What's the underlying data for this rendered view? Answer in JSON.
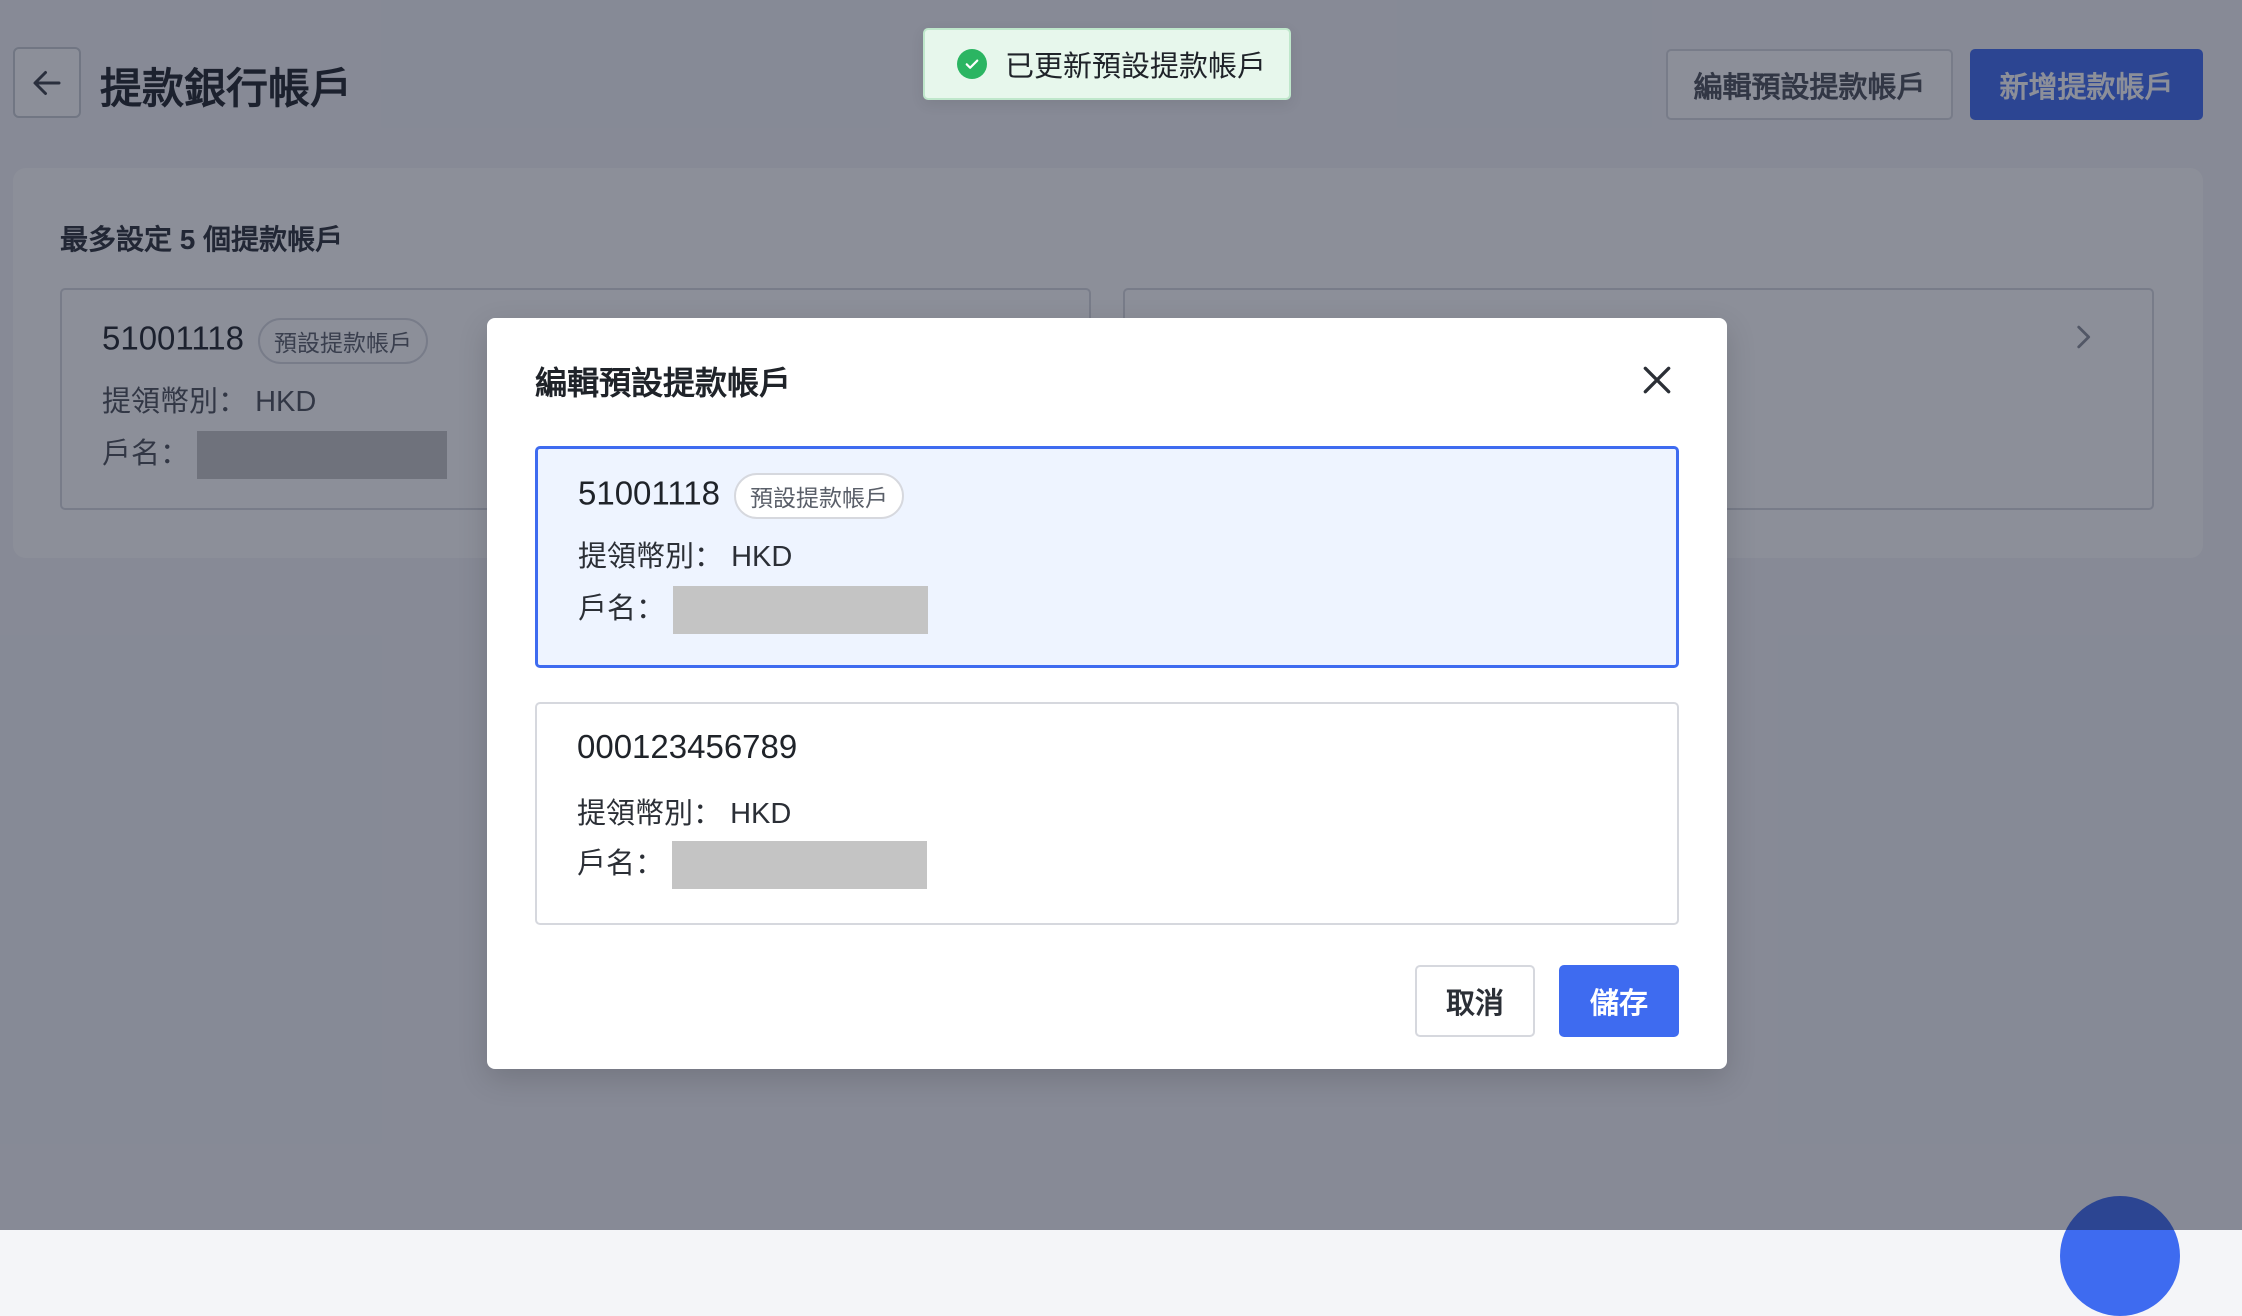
{
  "page": {
    "title": "提款銀行帳戶",
    "edit_default_button": "編輯預設提款帳戶",
    "add_button": "新增提款帳戶",
    "max_note": "最多設定 5 個提款帳戶",
    "cards": [
      {
        "account_number": "51001118",
        "tag": "預設提款帳戶",
        "currency_label": "提領幣別：",
        "currency": "HKD",
        "name_label": "戶名："
      }
    ]
  },
  "toast": {
    "message": "已更新預設提款帳戶",
    "icon": "check-circle-icon",
    "color": "#2bb562"
  },
  "modal": {
    "title": "編輯預設提款帳戶",
    "accounts": [
      {
        "account_number": "51001118",
        "tag": "預設提款帳戶",
        "currency_label": "提領幣別：",
        "currency": "HKD",
        "name_label": "戶名：",
        "selected": true
      },
      {
        "account_number": "000123456789",
        "currency_label": "提領幣別：",
        "currency": "HKD",
        "name_label": "戶名：",
        "selected": false
      }
    ],
    "cancel_button": "取消",
    "save_button": "儲存"
  },
  "colors": {
    "accent": "#3e6bf0",
    "success": "#2bb562",
    "redacted": "#c4c4c4"
  }
}
